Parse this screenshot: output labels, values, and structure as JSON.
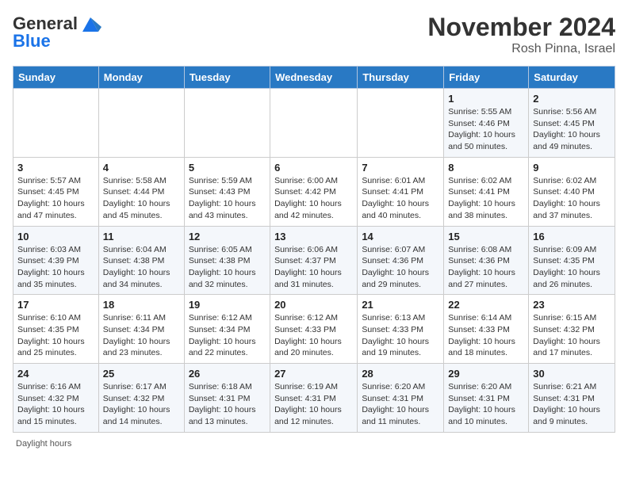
{
  "header": {
    "logo_general": "General",
    "logo_blue": "Blue",
    "month_title": "November 2024",
    "location": "Rosh Pinna, Israel"
  },
  "days_of_week": [
    "Sunday",
    "Monday",
    "Tuesday",
    "Wednesday",
    "Thursday",
    "Friday",
    "Saturday"
  ],
  "footer_text": "Daylight hours",
  "weeks": [
    [
      {
        "day": "",
        "info": ""
      },
      {
        "day": "",
        "info": ""
      },
      {
        "day": "",
        "info": ""
      },
      {
        "day": "",
        "info": ""
      },
      {
        "day": "",
        "info": ""
      },
      {
        "day": "1",
        "info": "Sunrise: 5:55 AM\nSunset: 4:46 PM\nDaylight: 10 hours\nand 50 minutes."
      },
      {
        "day": "2",
        "info": "Sunrise: 5:56 AM\nSunset: 4:45 PM\nDaylight: 10 hours\nand 49 minutes."
      }
    ],
    [
      {
        "day": "3",
        "info": "Sunrise: 5:57 AM\nSunset: 4:45 PM\nDaylight: 10 hours\nand 47 minutes."
      },
      {
        "day": "4",
        "info": "Sunrise: 5:58 AM\nSunset: 4:44 PM\nDaylight: 10 hours\nand 45 minutes."
      },
      {
        "day": "5",
        "info": "Sunrise: 5:59 AM\nSunset: 4:43 PM\nDaylight: 10 hours\nand 43 minutes."
      },
      {
        "day": "6",
        "info": "Sunrise: 6:00 AM\nSunset: 4:42 PM\nDaylight: 10 hours\nand 42 minutes."
      },
      {
        "day": "7",
        "info": "Sunrise: 6:01 AM\nSunset: 4:41 PM\nDaylight: 10 hours\nand 40 minutes."
      },
      {
        "day": "8",
        "info": "Sunrise: 6:02 AM\nSunset: 4:41 PM\nDaylight: 10 hours\nand 38 minutes."
      },
      {
        "day": "9",
        "info": "Sunrise: 6:02 AM\nSunset: 4:40 PM\nDaylight: 10 hours\nand 37 minutes."
      }
    ],
    [
      {
        "day": "10",
        "info": "Sunrise: 6:03 AM\nSunset: 4:39 PM\nDaylight: 10 hours\nand 35 minutes."
      },
      {
        "day": "11",
        "info": "Sunrise: 6:04 AM\nSunset: 4:38 PM\nDaylight: 10 hours\nand 34 minutes."
      },
      {
        "day": "12",
        "info": "Sunrise: 6:05 AM\nSunset: 4:38 PM\nDaylight: 10 hours\nand 32 minutes."
      },
      {
        "day": "13",
        "info": "Sunrise: 6:06 AM\nSunset: 4:37 PM\nDaylight: 10 hours\nand 31 minutes."
      },
      {
        "day": "14",
        "info": "Sunrise: 6:07 AM\nSunset: 4:36 PM\nDaylight: 10 hours\nand 29 minutes."
      },
      {
        "day": "15",
        "info": "Sunrise: 6:08 AM\nSunset: 4:36 PM\nDaylight: 10 hours\nand 27 minutes."
      },
      {
        "day": "16",
        "info": "Sunrise: 6:09 AM\nSunset: 4:35 PM\nDaylight: 10 hours\nand 26 minutes."
      }
    ],
    [
      {
        "day": "17",
        "info": "Sunrise: 6:10 AM\nSunset: 4:35 PM\nDaylight: 10 hours\nand 25 minutes."
      },
      {
        "day": "18",
        "info": "Sunrise: 6:11 AM\nSunset: 4:34 PM\nDaylight: 10 hours\nand 23 minutes."
      },
      {
        "day": "19",
        "info": "Sunrise: 6:12 AM\nSunset: 4:34 PM\nDaylight: 10 hours\nand 22 minutes."
      },
      {
        "day": "20",
        "info": "Sunrise: 6:12 AM\nSunset: 4:33 PM\nDaylight: 10 hours\nand 20 minutes."
      },
      {
        "day": "21",
        "info": "Sunrise: 6:13 AM\nSunset: 4:33 PM\nDaylight: 10 hours\nand 19 minutes."
      },
      {
        "day": "22",
        "info": "Sunrise: 6:14 AM\nSunset: 4:33 PM\nDaylight: 10 hours\nand 18 minutes."
      },
      {
        "day": "23",
        "info": "Sunrise: 6:15 AM\nSunset: 4:32 PM\nDaylight: 10 hours\nand 17 minutes."
      }
    ],
    [
      {
        "day": "24",
        "info": "Sunrise: 6:16 AM\nSunset: 4:32 PM\nDaylight: 10 hours\nand 15 minutes."
      },
      {
        "day": "25",
        "info": "Sunrise: 6:17 AM\nSunset: 4:32 PM\nDaylight: 10 hours\nand 14 minutes."
      },
      {
        "day": "26",
        "info": "Sunrise: 6:18 AM\nSunset: 4:31 PM\nDaylight: 10 hours\nand 13 minutes."
      },
      {
        "day": "27",
        "info": "Sunrise: 6:19 AM\nSunset: 4:31 PM\nDaylight: 10 hours\nand 12 minutes."
      },
      {
        "day": "28",
        "info": "Sunrise: 6:20 AM\nSunset: 4:31 PM\nDaylight: 10 hours\nand 11 minutes."
      },
      {
        "day": "29",
        "info": "Sunrise: 6:20 AM\nSunset: 4:31 PM\nDaylight: 10 hours\nand 10 minutes."
      },
      {
        "day": "30",
        "info": "Sunrise: 6:21 AM\nSunset: 4:31 PM\nDaylight: 10 hours\nand 9 minutes."
      }
    ]
  ]
}
